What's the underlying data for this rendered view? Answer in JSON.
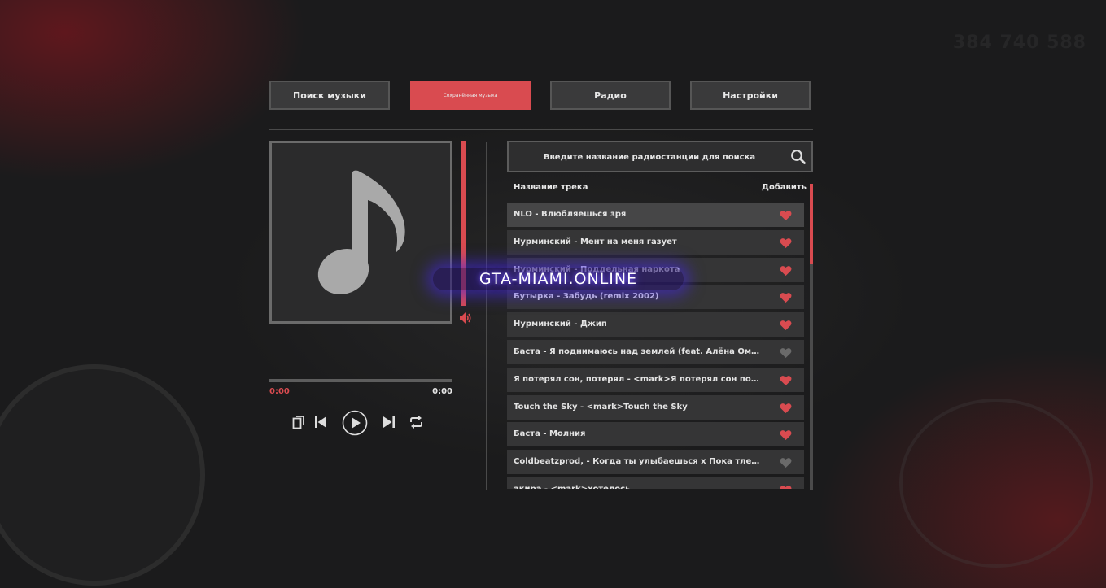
{
  "tabs": [
    {
      "label": "Поиск музыки",
      "active": false
    },
    {
      "label": "Сохранённая музыка",
      "active": true
    },
    {
      "label": "Радио",
      "active": false
    },
    {
      "label": "Настройки",
      "active": false
    }
  ],
  "player": {
    "art_icon": "music-note-icon",
    "current_time": "0:00",
    "total_time": "0:00",
    "progress": 0,
    "volume": 1.0,
    "controls": [
      "copy-icon",
      "skip-previous-icon",
      "play-icon",
      "skip-next-icon",
      "repeat-icon"
    ]
  },
  "search": {
    "placeholder": "Введите название радиостанции для поиска",
    "icon": "search-icon"
  },
  "list": {
    "header_title": "Название трека",
    "header_add": "Добавить",
    "tracks": [
      {
        "title": "NLO - Влюбляешься зря",
        "liked": true,
        "highlighted": true
      },
      {
        "title": "Нурминский - Мент на меня газует",
        "liked": true
      },
      {
        "title": "Нурминский - Поддельная наркота",
        "liked": true
      },
      {
        "title": "Бутырка - Забудь (remix 2002)",
        "liked": true
      },
      {
        "title": "Нурминский - Джип",
        "liked": true
      },
      {
        "title": "Баста - Я поднимаюсь над землей (feat. Алёна Омаргалиева)",
        "liked": false
      },
      {
        "title": "Я потерял сон, потерял - <mark>Я потерял сон потерял покой",
        "liked": true
      },
      {
        "title": "Touch the Sky - <mark>Touch the Sky",
        "liked": true
      },
      {
        "title": "Баста - Молния",
        "liked": true
      },
      {
        "title": "Coldbeatzprod, - Когда ты улыбаешься x Пока тлеет г...",
        "liked": false
      },
      {
        "title": "акира - <mark>хотелось",
        "liked": true
      }
    ]
  },
  "watermark": "GTA-MIAMI.ONLINE",
  "hud": {
    "money": "384 740 588"
  },
  "colors": {
    "accent": "#d94b50",
    "heart_off": "#6a6a6a",
    "panel": "#353536"
  }
}
